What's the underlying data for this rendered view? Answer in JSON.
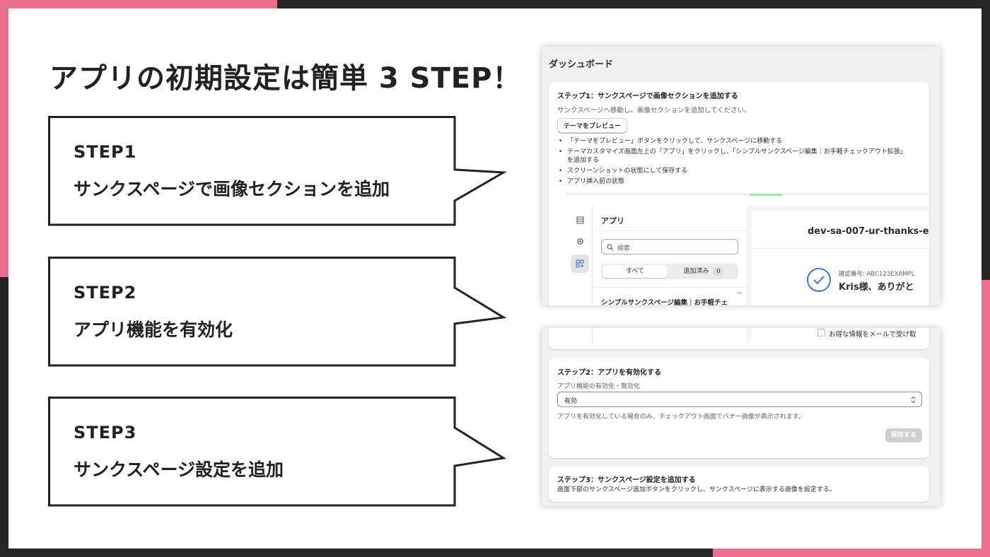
{
  "slide": {
    "title": "アプリの初期設定は簡単 3 STEP！",
    "colors": {
      "accent": "#ea7090",
      "frame": "#262626",
      "text": "#222222"
    },
    "steps": [
      {
        "label": "STEP1",
        "desc": "サンクスページで画像セクションを追加"
      },
      {
        "label": "STEP2",
        "desc": "アプリ機能を有効化"
      },
      {
        "label": "STEP3",
        "desc": "サンクスページ設定を追加"
      }
    ]
  },
  "dashboard": {
    "title": "ダッシュボード",
    "step1": {
      "heading": "ステップ1：サンクスページで画像セクションを追加する",
      "sub": "サンクスページへ移動し、画像セクションを追加してください。",
      "button": "テーマをプレビュー",
      "bullets": [
        "「テーマをプレビュー」ボタンをクリックして、サンクスページに移動する",
        "テーマカスタマイズ画面左上の「アプリ」をクリックし、「シンプルサンクスページ編集｜お手軽チェックアウト拡張」",
        "を追加する",
        "スクリーンショットの状態にして保存する",
        "アプリ挿入前の状態"
      ]
    },
    "editor": {
      "apps_title": "アプリ",
      "search_placeholder": "検索",
      "tab_all": "すべて",
      "tab_added": "追加済み",
      "tab_added_count": "0",
      "app_item": "シンプルサンクスページ編集｜お手軽チェ",
      "store_name": "dev-sa-007-ur-thanks-e",
      "confirm_label": "確認番号: ABC123EXAMPL",
      "thanks_text": "Kris様、ありがと",
      "newsletter": "お得な情報をメールで受け取"
    },
    "step2": {
      "heading": "ステップ2：アプリを有効化する",
      "field_label": "アプリ機能の有効化・無効化",
      "select_value": "有効",
      "help": "アプリを有効化している場合のみ、チェックアウト画面でバナー画像が表示されます。",
      "save_button": "保存する"
    },
    "step3": {
      "heading": "ステップ3：サンクスページ設定を追加する",
      "text": "画面下部のサンクスページ追加ボタンをクリックし、サンクスページに表示する画像を設定する。"
    }
  }
}
